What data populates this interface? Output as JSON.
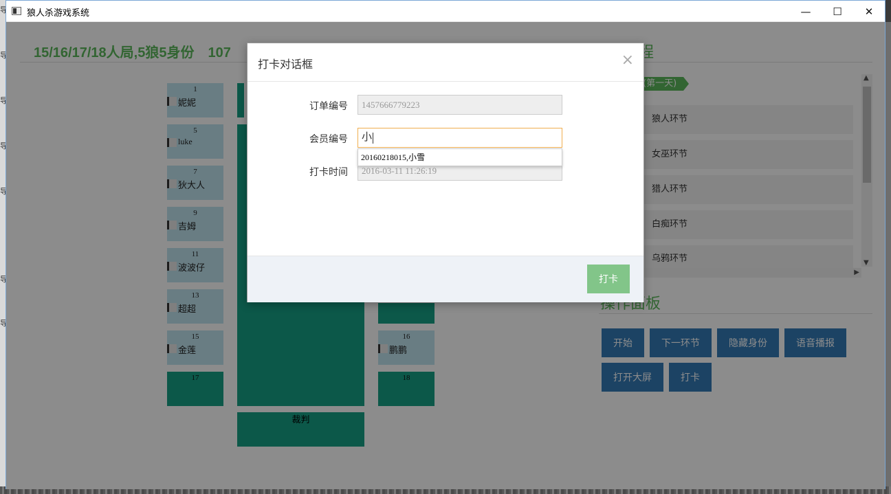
{
  "window": {
    "title": "狼人杀游戏系统",
    "controls": [
      "—",
      "☐",
      "✕"
    ]
  },
  "desktop": {
    "left_glyphs": [
      "导",
      "导",
      "导",
      "导",
      "导",
      "导",
      "导"
    ]
  },
  "game": {
    "heading": "15/16/17/18人局,5狼5身份　107",
    "process_title": "程",
    "seats": [
      {
        "num": "1",
        "name": "妮妮"
      },
      {
        "num": "5",
        "name": "luke"
      },
      {
        "num": "7",
        "name": "狄大人"
      },
      {
        "num": "9",
        "name": "吉姆"
      },
      {
        "num": "11",
        "name": "波波仔"
      },
      {
        "num": "13",
        "name": "超超"
      },
      {
        "num": "15",
        "name": "金莲"
      },
      {
        "num": "17",
        "name": ""
      },
      {
        "num": "16",
        "name": "鹏鹏"
      },
      {
        "num": "18",
        "name": ""
      }
    ],
    "judge": "裁判",
    "day_label": "(第一天)",
    "phases": [
      "狼人环节",
      "女巫环节",
      "猎人环节",
      "白痴环节",
      "乌鸦环节"
    ],
    "panel_title": "操作面板",
    "buttons": [
      "开始",
      "下一环节",
      "隐藏身份",
      "语音播报",
      "打开大屏",
      "打卡"
    ]
  },
  "dialog": {
    "title": "打卡对话框",
    "close": "×",
    "order_label": "订单编号",
    "order_value": "1457666779223",
    "member_label": "会员编号",
    "member_value": "小",
    "suggestion": "20160218015,小雪",
    "time_label": "打卡时间",
    "time_value": "2016-03-11 11:26:19",
    "submit": "打卡"
  },
  "colors": {
    "accent_green": "#5cb85c",
    "seat_teal": "#16a085",
    "button_blue": "#337ab7",
    "submit_green": "#82c589",
    "input_focus": "#f0ad4e"
  }
}
